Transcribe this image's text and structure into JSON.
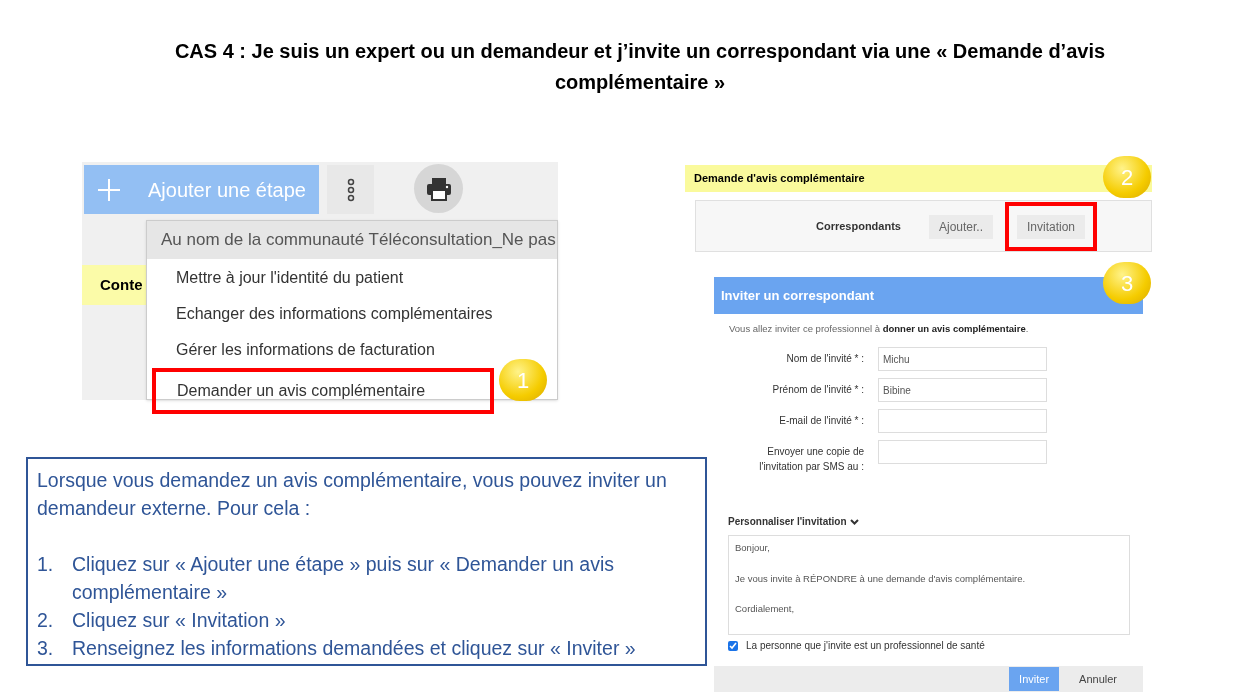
{
  "slide_title": "CAS 4 : Je suis un expert ou un demandeur et j’invite un correspondant via une « Demande d’avis complémentaire »",
  "screenshot_1": {
    "add_step_button": "Ajouter une étape",
    "partial_label": "Conte",
    "menu": {
      "header": "Au nom de la communauté Téléconsultation_Ne pas",
      "items": [
        {
          "label": "Mettre à jour l'identité du patient",
          "annotated": false
        },
        {
          "label": "Echanger des informations complémentaires",
          "annotated": false
        },
        {
          "label": "Gérer les informations de facturation",
          "annotated": false
        },
        {
          "label": "Demander un avis complémentaire",
          "annotated": true
        }
      ]
    },
    "callout": "1"
  },
  "screenshot_2": {
    "title": "Demande d'avis complémentaire",
    "callout": "2",
    "label": "Correspondants",
    "buttons": [
      {
        "label": "Ajouter..",
        "annotated": false
      },
      {
        "label": "Invitation",
        "annotated": true
      }
    ]
  },
  "dialog": {
    "title": "Inviter un correspondant",
    "callout": "3",
    "intro": "Vous allez inviter ce professionnel à **donner un avis complémentaire**.",
    "fields": [
      {
        "label": "Nom de l'invité * :",
        "value": "Michu"
      },
      {
        "label": "Prénom de l'invité * :",
        "value": "Bibine"
      },
      {
        "label": "E-mail de l'invité * :"
      },
      {
        "label": "Envoyer une copie de l'invitation par SMS au :"
      }
    ],
    "customize_toggle": "Personnaliser l'invitation",
    "message_lines": [
      "Bonjour,",
      "Je vous invite à RÉPONDRE à une demande d'avis complémentaire.",
      "Cordialement,"
    ],
    "checkbox": {
      "label": "La personne que j'invite est un professionnel de santé",
      "checked": true
    },
    "buttons": [
      {
        "label": "Inviter",
        "kind": "primary"
      },
      {
        "label": "Annuler",
        "kind": "plain"
      }
    ]
  },
  "instructions": {
    "intro": "Lorsque vous demandez un avis complémentaire, vous pouvez inviter un demandeur externe. Pour cela :",
    "steps": [
      {
        "number": "1.",
        "text": "Cliquez sur « Ajouter une étape » puis sur « Demander un avis complémentaire »"
      },
      {
        "number": "2.",
        "text": "Cliquez sur « Invitation »"
      },
      {
        "number": "3.",
        "text": "Renseignez les informations demandées et cliquez sur « Inviter »"
      }
    ]
  }
}
